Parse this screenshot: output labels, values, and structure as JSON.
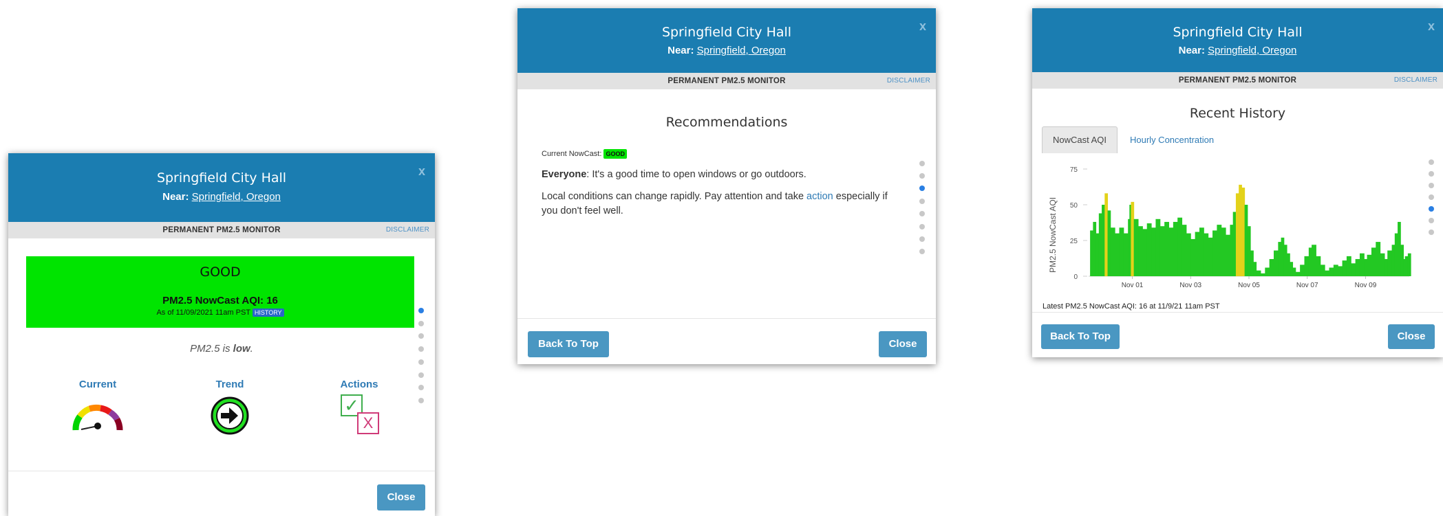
{
  "panel1": {
    "title": "Springfield City Hall",
    "near_label": "Near:",
    "near_link": "Springfield, Oregon",
    "close_x": "x",
    "monitor_type": "PERMANENT PM2.5 MONITOR",
    "disclaimer": "DISCLAIMER",
    "aqi_category": "GOOD",
    "aqi_line": "PM2.5 NowCast AQI: 16",
    "as_of": "As of 11/09/2021 11am PST",
    "history_badge": "HISTORY",
    "pm_text_prefix": "PM2.5 is ",
    "pm_level": "low",
    "pm_text_suffix": ".",
    "current_label": "Current",
    "trend_label": "Trend",
    "actions_label": "Actions",
    "action_check": "✓",
    "action_x": "X",
    "close_button": "Close",
    "colors": {
      "aqi_bg": "#00e400",
      "header": "#1b7db1"
    }
  },
  "panel2": {
    "title": "Springfield City Hall",
    "near_label": "Near:",
    "near_link": "Springfield, Oregon",
    "close_x": "x",
    "monitor_type": "PERMANENT PM2.5 MONITOR",
    "disclaimer": "DISCLAIMER",
    "heading": "Recommendations",
    "nowcast_label": "Current NowCast:",
    "nowcast_badge": "GOOD",
    "everyone_bold": "Everyone",
    "everyone_text": ": It's a good time to open windows or go outdoors.",
    "local_text_1": "Local conditions can change rapidly. Pay attention and take ",
    "action_link": "action",
    "local_text_2": " especially if",
    "local_text_3": "you don't feel well.",
    "back_button": "Back To Top",
    "close_button": "Close"
  },
  "panel3": {
    "title": "Springfield City Hall",
    "near_label": "Near:",
    "near_link": "Springfield, Oregon",
    "close_x": "x",
    "monitor_type": "PERMANENT PM2.5 MONITOR",
    "disclaimer": "DISCLAIMER",
    "heading": "Recent History",
    "tab_nowcast": "NowCast AQI",
    "tab_hourly": "Hourly Concentration",
    "latest": "Latest PM2.5 NowCast AQI: 16 at 11/9/21 11am PST",
    "back_button": "Back To Top",
    "close_button": "Close"
  },
  "chart_data": {
    "type": "area",
    "title": "",
    "xlabel": "",
    "ylabel": "PM2.5 NowCast AQI",
    "ylim": [
      0,
      75
    ],
    "yticks": [
      "75",
      "50",
      "25",
      "0"
    ],
    "xticks": [
      "Nov 01",
      "Nov 03",
      "Nov 05",
      "Nov 07",
      "Nov 09"
    ],
    "x_range_days": [
      -1.5,
      9.5
    ],
    "points": [
      [
        -1.45,
        32
      ],
      [
        -1.35,
        38
      ],
      [
        -1.25,
        30
      ],
      [
        -1.15,
        44
      ],
      [
        -1.05,
        50
      ],
      [
        -0.95,
        58
      ],
      [
        -0.85,
        46
      ],
      [
        -0.75,
        34
      ],
      [
        -0.6,
        30
      ],
      [
        -0.45,
        34
      ],
      [
        -0.3,
        30
      ],
      [
        -0.15,
        40
      ],
      [
        -0.1,
        50
      ],
      [
        -0.05,
        52
      ],
      [
        0.05,
        40
      ],
      [
        0.2,
        35
      ],
      [
        0.35,
        33
      ],
      [
        0.5,
        37
      ],
      [
        0.65,
        34
      ],
      [
        0.8,
        40
      ],
      [
        0.95,
        35
      ],
      [
        1.1,
        38
      ],
      [
        1.25,
        34
      ],
      [
        1.4,
        38
      ],
      [
        1.55,
        41
      ],
      [
        1.7,
        36
      ],
      [
        1.85,
        30
      ],
      [
        2.0,
        26
      ],
      [
        2.15,
        31
      ],
      [
        2.3,
        34
      ],
      [
        2.45,
        30
      ],
      [
        2.6,
        27
      ],
      [
        2.75,
        32
      ],
      [
        2.9,
        36
      ],
      [
        3.05,
        34
      ],
      [
        3.2,
        29
      ],
      [
        3.35,
        36
      ],
      [
        3.45,
        45
      ],
      [
        3.55,
        58
      ],
      [
        3.65,
        64
      ],
      [
        3.75,
        62
      ],
      [
        3.85,
        50
      ],
      [
        3.95,
        35
      ],
      [
        4.05,
        18
      ],
      [
        4.15,
        10
      ],
      [
        4.25,
        4
      ],
      [
        4.4,
        2
      ],
      [
        4.55,
        6
      ],
      [
        4.7,
        12
      ],
      [
        4.85,
        18
      ],
      [
        5.0,
        24
      ],
      [
        5.1,
        27
      ],
      [
        5.2,
        22
      ],
      [
        5.3,
        16
      ],
      [
        5.4,
        10
      ],
      [
        5.5,
        6
      ],
      [
        5.6,
        3
      ],
      [
        5.75,
        8
      ],
      [
        5.9,
        14
      ],
      [
        6.05,
        20
      ],
      [
        6.15,
        22
      ],
      [
        6.3,
        14
      ],
      [
        6.45,
        8
      ],
      [
        6.6,
        4
      ],
      [
        6.75,
        6
      ],
      [
        6.9,
        8
      ],
      [
        7.05,
        7
      ],
      [
        7.2,
        11
      ],
      [
        7.35,
        14
      ],
      [
        7.5,
        9
      ],
      [
        7.65,
        12
      ],
      [
        7.8,
        16
      ],
      [
        7.95,
        12
      ],
      [
        8.05,
        15
      ],
      [
        8.2,
        20
      ],
      [
        8.35,
        24
      ],
      [
        8.5,
        16
      ],
      [
        8.65,
        12
      ],
      [
        8.75,
        18
      ],
      [
        8.9,
        22
      ],
      [
        9.0,
        30
      ],
      [
        9.1,
        38
      ],
      [
        9.2,
        22
      ],
      [
        9.3,
        12
      ],
      [
        9.35,
        14
      ],
      [
        9.45,
        16
      ]
    ],
    "colors": {
      "good": "#23c823",
      "moderate": "#e3d21a"
    },
    "moderate_threshold": 50
  }
}
